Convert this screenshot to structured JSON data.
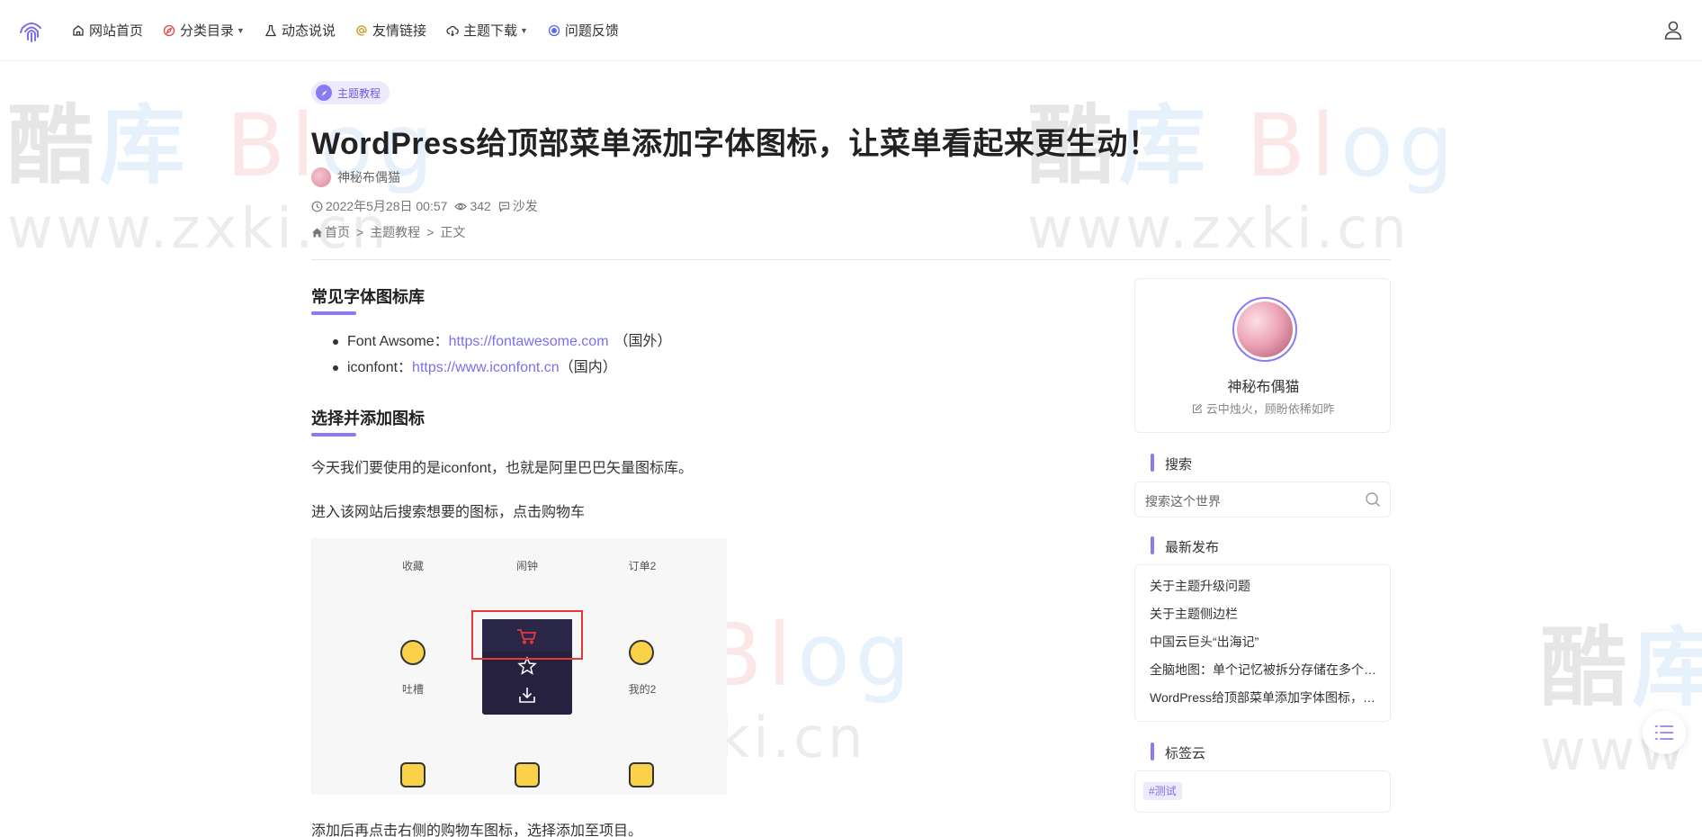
{
  "nav": {
    "items": [
      {
        "label": "网站首页",
        "icon": "home-icon",
        "caret": false
      },
      {
        "label": "分类目录",
        "icon": "compass-icon",
        "caret": true
      },
      {
        "label": "动态说说",
        "icon": "flask-icon",
        "caret": false
      },
      {
        "label": "友情链接",
        "icon": "at-icon",
        "caret": false
      },
      {
        "label": "主题下载",
        "icon": "cloud-icon",
        "caret": true
      },
      {
        "label": "问题反馈",
        "icon": "feedback-icon",
        "caret": false
      }
    ]
  },
  "watermark": {
    "line1_a": "酷",
    "line1_b": "库",
    "line1_c": "Bl",
    "line1_d": "og",
    "line2": "www.zxki.cn"
  },
  "article": {
    "category": "主题教程",
    "title": "WordPress给顶部菜单添加字体图标，让菜单看起来更生动！",
    "author": "神秘布偶猫",
    "date": "2022年5月28日 00:57",
    "views": "342",
    "comments": "沙发",
    "breadcrumb": [
      "首页",
      "主题教程",
      "正文"
    ],
    "section1": "常见字体图标库",
    "list": [
      {
        "prefix": "Font Awsome：",
        "link": "https://fontawesome.com",
        "suffix": "（国外）"
      },
      {
        "prefix": "iconfont：",
        "link": "https://www.iconfont.cn",
        "suffix": "（国内）"
      }
    ],
    "section2": "选择并添加图标",
    "para1": "今天我们要使用的是iconfont，也就是阿里巴巴矢量图标库。",
    "para2": "进入该网站后搜索想要的图标，点击购物车",
    "para3": "添加后再点击右侧的购物车图标，选择添加至项目。"
  },
  "screenshot": {
    "labels": [
      "收藏",
      "闹钟",
      "订单2",
      "吐槽",
      "我的2"
    ]
  },
  "sidebar": {
    "profile_name": "神秘布偶猫",
    "profile_desc": "云中烛火，顾盼依稀如昨",
    "search_title": "搜索",
    "search_placeholder": "搜索这个世界",
    "recent_title": "最新发布",
    "recent": [
      "关于主题升级问题",
      "关于主题侧边栏",
      "中国云巨头“出海记”",
      "全脑地图：单个记忆被拆分存储在多个脑区",
      "WordPress给顶部菜单添加字体图标，让菜单看起来更生动！"
    ],
    "tags_title": "标签云",
    "tags": [
      "#测试"
    ]
  },
  "colors": {
    "accent": "#8a7cf0",
    "link": "#7b6ff0",
    "highlight": "#e53935"
  }
}
